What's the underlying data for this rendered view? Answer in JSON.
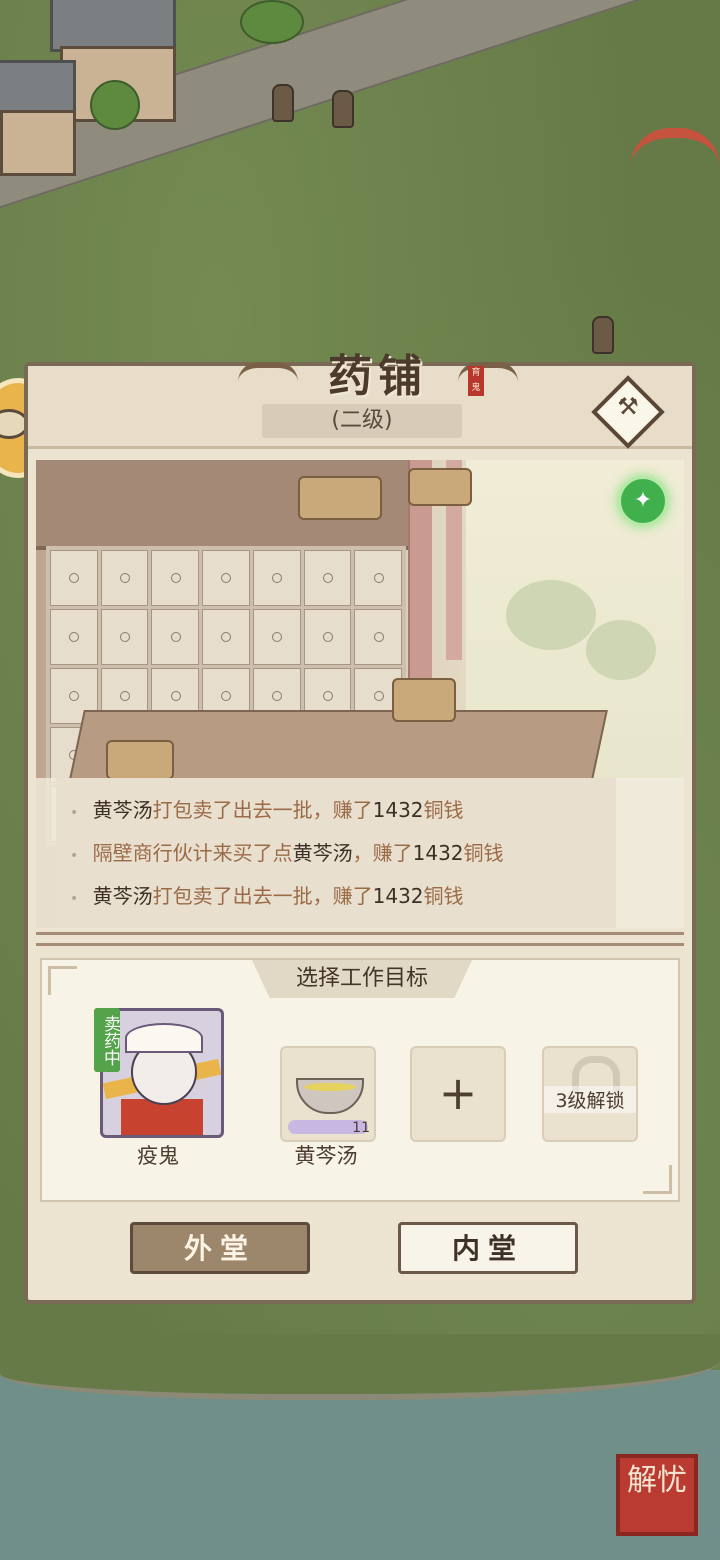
{
  "shop": {
    "title": "药铺",
    "level": "(二级)",
    "title_stamp": "育鬼"
  },
  "log": {
    "lines": [
      {
        "a": "黄芩汤",
        "b": "打包卖了出去一批，赚了",
        "c": "1432",
        "d": "铜钱"
      },
      {
        "a": "隔壁商行伙计来买了点",
        "b": "黄芩汤",
        "c": "，赚了",
        "d": "1432",
        "e": "铜钱"
      },
      {
        "a": "黄芩汤",
        "b": "打包卖了出去一批，赚了",
        "c": "1432",
        "d": "铜钱"
      }
    ]
  },
  "work": {
    "title": "选择工作目标",
    "worker": {
      "name": "疫鬼",
      "status": "卖药中"
    },
    "product": {
      "name": "黄芩汤",
      "count": "11"
    },
    "add_slot": "+",
    "locked_slot": "3级解锁"
  },
  "buttons": {
    "outer": "外堂",
    "inner": "内堂"
  },
  "corner_seal": "解忧",
  "colors": {
    "panel_bg": "#ece3d1",
    "border": "#7a6a55",
    "accent_green": "#52a34a",
    "seal_red": "#b93b32"
  },
  "icons": [
    "hammer-icon",
    "gift-icon",
    "coin-icon",
    "plus-icon",
    "lock-icon"
  ]
}
